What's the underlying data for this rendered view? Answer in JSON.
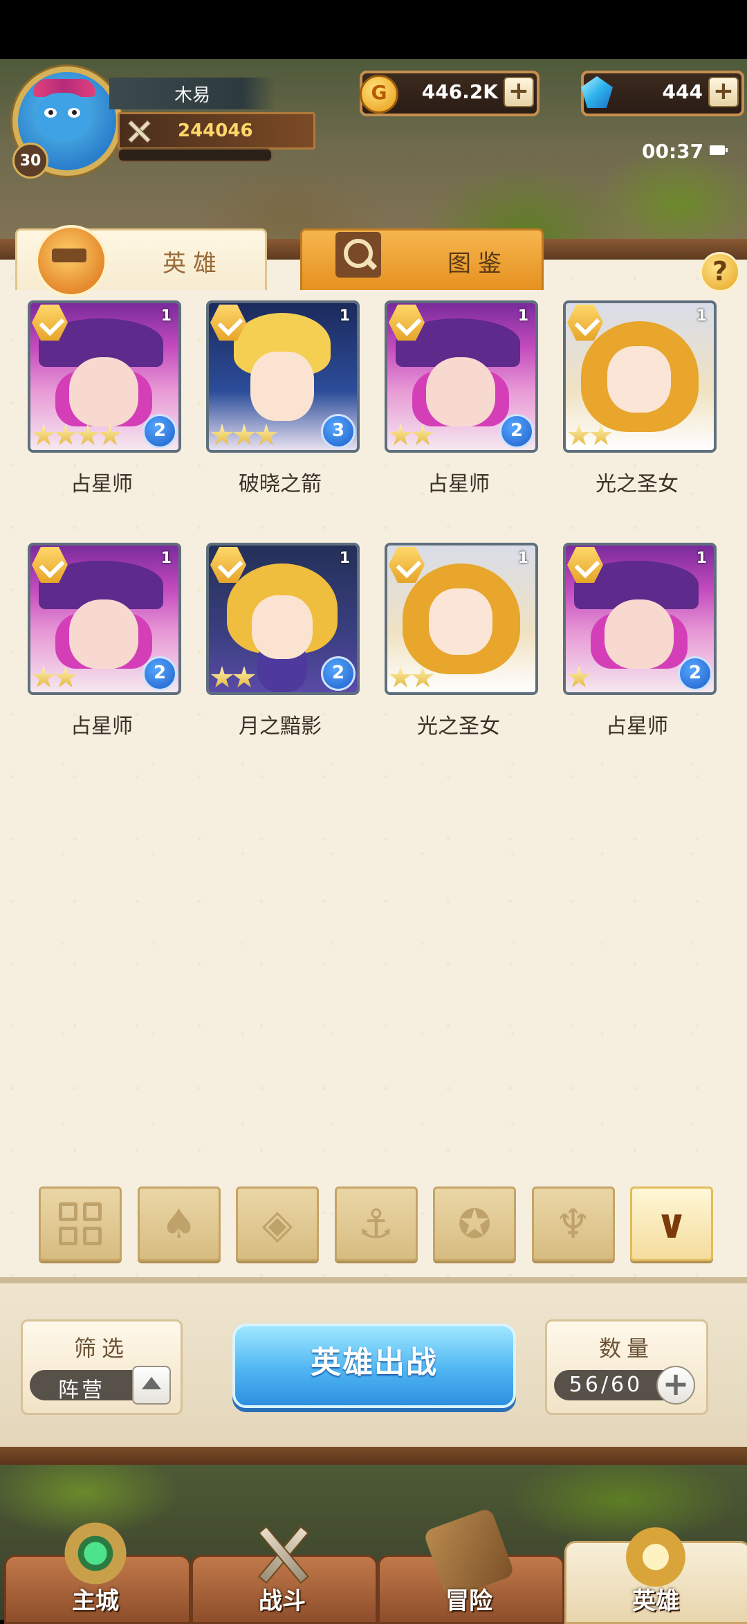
{
  "player": {
    "name": "木易",
    "level": "30",
    "power": "244046"
  },
  "resources": {
    "gold": "446.2K",
    "diamonds": "444"
  },
  "status": {
    "time": "00:37"
  },
  "tabs": [
    {
      "label": "英雄"
    },
    {
      "label": "图鉴"
    }
  ],
  "help_label": "?",
  "heroes": [
    {
      "name": "占星师",
      "level": "1",
      "stars": 4,
      "rank": "2",
      "portrait": "witch"
    },
    {
      "name": "破晓之箭",
      "level": "1",
      "stars": 3,
      "rank": "3",
      "portrait": "blond-archer"
    },
    {
      "name": "占星师",
      "level": "1",
      "stars": 2,
      "rank": "2",
      "portrait": "witch"
    },
    {
      "name": "光之圣女",
      "level": "1",
      "stars": 2,
      "rank": "",
      "portrait": "saint"
    },
    {
      "name": "占星师",
      "level": "1",
      "stars": 2,
      "rank": "2",
      "portrait": "witch"
    },
    {
      "name": "月之黯影",
      "level": "1",
      "stars": 2,
      "rank": "2",
      "portrait": "moon-shadow"
    },
    {
      "name": "光之圣女",
      "level": "1",
      "stars": 2,
      "rank": "",
      "portrait": "saint"
    },
    {
      "name": "占星师",
      "level": "1",
      "stars": 1,
      "rank": "2",
      "portrait": "witch"
    }
  ],
  "faction_filters": [
    {
      "icon": "all-grid-icon",
      "active": false
    },
    {
      "icon": "leaf-faction-icon",
      "active": false
    },
    {
      "icon": "diamond-faction-icon",
      "active": false
    },
    {
      "icon": "anchor-faction-icon",
      "active": false
    },
    {
      "icon": "beast-faction-icon",
      "active": false
    },
    {
      "icon": "horned-faction-icon",
      "active": false
    },
    {
      "icon": "chevron-faction-icon",
      "active": true
    }
  ],
  "filter_box": {
    "title": "筛选",
    "value": "阵营"
  },
  "deploy_label": "英雄出战",
  "count_box": {
    "title": "数量",
    "value": "56/60"
  },
  "nav": [
    {
      "label": "主城",
      "icon": "castle-icon",
      "active": false
    },
    {
      "label": "战斗",
      "icon": "swords-icon",
      "active": false
    },
    {
      "label": "冒险",
      "icon": "map-icon",
      "active": false
    },
    {
      "label": "英雄",
      "icon": "hero-crest-icon",
      "active": true
    }
  ],
  "colors": {
    "accent_blue": "#4fb6f2",
    "gold": "#e6a52a",
    "paper": "#f6efe0"
  }
}
